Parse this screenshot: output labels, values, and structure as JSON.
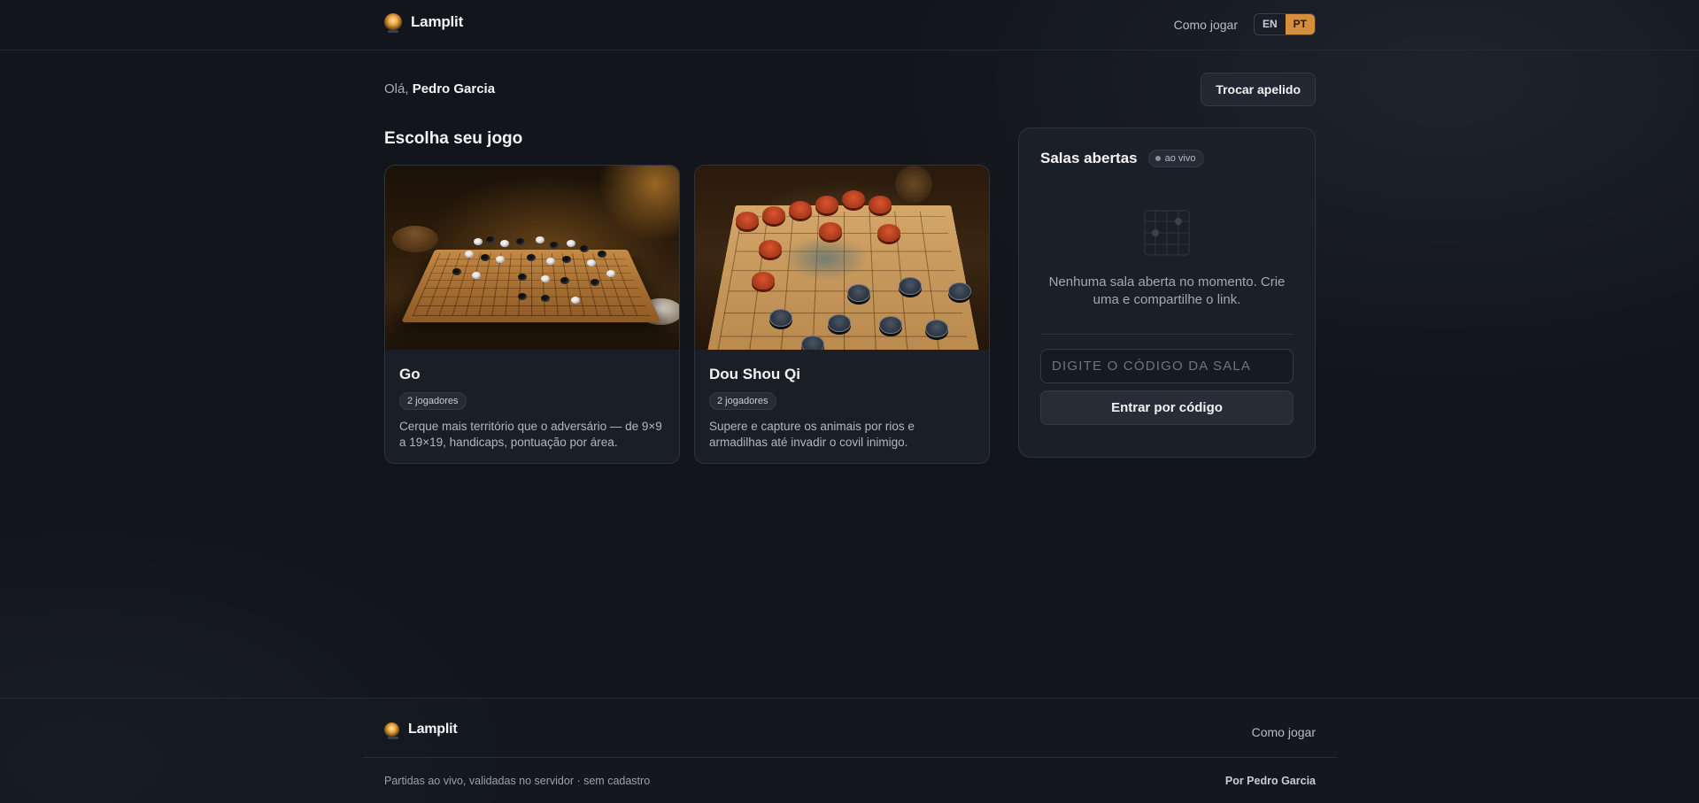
{
  "header": {
    "brand": "Lamplit",
    "how_to_play": "Como jogar",
    "languages": [
      {
        "code": "EN",
        "active": false
      },
      {
        "code": "PT",
        "active": true
      }
    ]
  },
  "greeting": {
    "prefix": "Olá,",
    "name": "Pedro Garcia",
    "change_nick_label": "Trocar apelido"
  },
  "games": {
    "section_title": "Escolha seu jogo",
    "items": [
      {
        "title": "Go",
        "players": "2 jogadores",
        "description": "Cerque mais território que o adversário — de 9×9 a 19×19, handicaps, pontuação por área."
      },
      {
        "title": "Dou Shou Qi",
        "players": "2 jogadores",
        "description": "Supere e capture os animais por rios e armadilhas até invadir o covil inimigo."
      }
    ]
  },
  "rooms": {
    "title": "Salas abertas",
    "live_badge": "ao vivo",
    "empty_message": "Nenhuma sala aberta no momento. Crie uma e compartilhe o link.",
    "code_placeholder": "DIGITE O CÓDIGO DA SALA",
    "enter_label": "Entrar por código"
  },
  "footer": {
    "brand": "Lamplit",
    "how_to_play": "Como jogar",
    "tagline": "Partidas ao vivo, validadas no servidor · sem cadastro",
    "author": "Por Pedro Garcia"
  },
  "colors": {
    "background": "#12151b",
    "accent": "#d58e3b",
    "card": "#1a1e26"
  }
}
